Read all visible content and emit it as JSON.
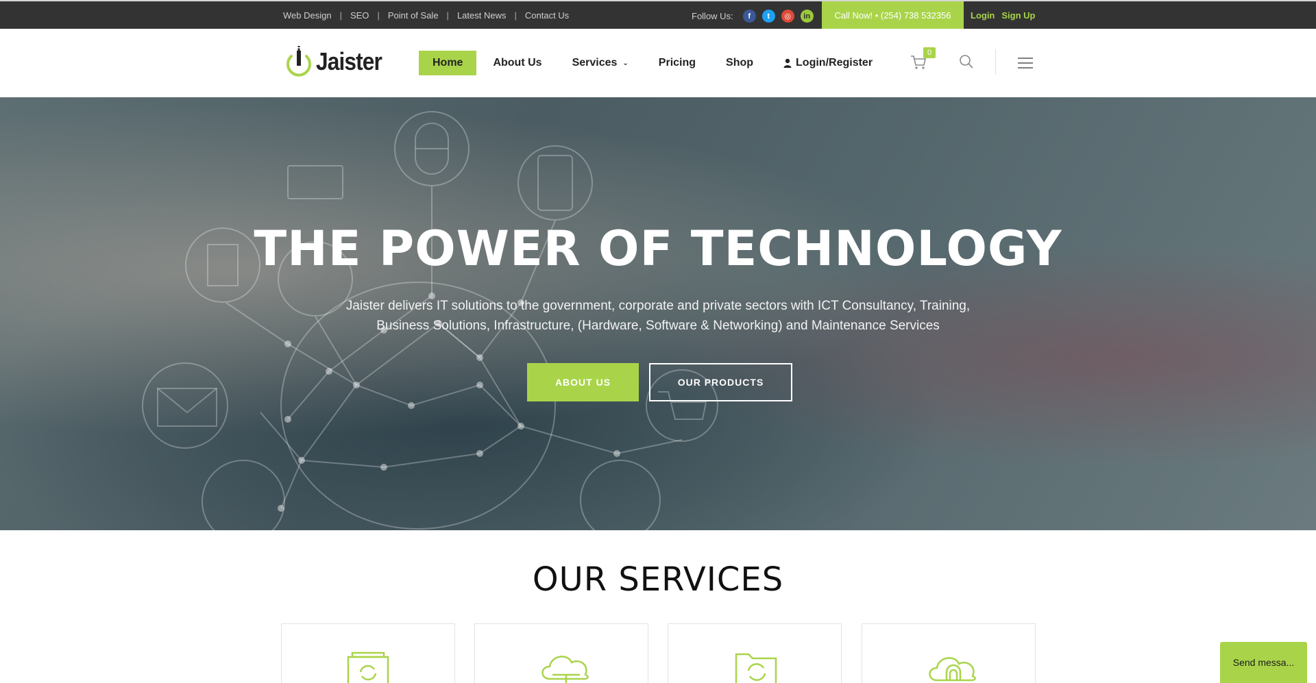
{
  "topbar": {
    "links": [
      "Web Design",
      "SEO",
      "Point of Sale",
      "Latest News",
      "Contact Us"
    ],
    "follow_label": "Follow Us:",
    "social": [
      {
        "icon": "facebook-icon",
        "glyph": "f"
      },
      {
        "icon": "twitter-icon",
        "glyph": "t"
      },
      {
        "icon": "instagram-icon",
        "glyph": "◎"
      },
      {
        "icon": "linkedin-icon",
        "glyph": "in"
      }
    ],
    "call_now": "Call Now! • (254) 738 532356",
    "login": "Login",
    "signup": "Sign Up"
  },
  "nav": {
    "brand": "Jaister",
    "items": {
      "home": "Home",
      "about": "About Us",
      "services": "Services",
      "pricing": "Pricing",
      "shop": "Shop",
      "login_register": "Login/Register"
    },
    "cart_count": "0"
  },
  "hero": {
    "title": "THE POWER OF TECHNOLOGY",
    "subtitle_line1": "Jaister delivers IT solutions to the government, corporate and private sectors with ICT Consultancy, Training,",
    "subtitle_line2": "Business Solutions, Infrastructure, (Hardware, Software & Networking) and Maintenance Services",
    "btn_about": "ABOUT US",
    "btn_products": "OUR PRODUCTS"
  },
  "services": {
    "title": "OUR SERVICES",
    "cards": [
      {
        "icon": "device-sync-icon"
      },
      {
        "icon": "cloud-network-icon"
      },
      {
        "icon": "folder-refresh-icon"
      },
      {
        "icon": "cloud-lock-icon"
      }
    ]
  },
  "chat": {
    "label": "Send messa..."
  },
  "colors": {
    "accent": "#a9d44a",
    "topbar": "#333333",
    "text": "#222222"
  }
}
